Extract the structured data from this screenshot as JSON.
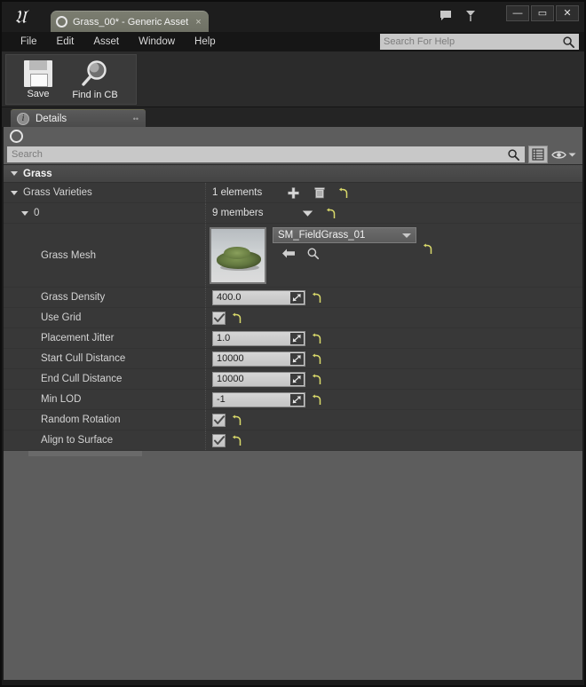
{
  "window": {
    "logo": "ue-logo",
    "asset_tab": {
      "title": "Grass_00* - Generic Asset",
      "close": "×"
    },
    "controls": {
      "minimize": "—",
      "maximize": "▭",
      "close": "✕"
    },
    "title_icons": [
      "feedback-icon",
      "bookmark-icon"
    ]
  },
  "menubar": {
    "items": [
      "File",
      "Edit",
      "Asset",
      "Window",
      "Help"
    ],
    "help_search_placeholder": "Search For Help"
  },
  "toolbar": {
    "buttons": [
      {
        "label": "Save",
        "icon": "save-icon"
      },
      {
        "label": "Find in CB",
        "icon": "magnifier-icon"
      }
    ]
  },
  "details_panel": {
    "tab_label": "Details",
    "tab_icon": "info-icon",
    "search_placeholder": "Search",
    "view_buttons": [
      "grid-view-icon",
      "eye-icon",
      "chevron-down-icon"
    ]
  },
  "properties": {
    "category": "Grass",
    "array": {
      "name": "Grass Varieties",
      "value": "1 elements",
      "actions": [
        "add-element-icon",
        "delete-all-icon",
        "reset-icon"
      ]
    },
    "element": {
      "name": "0",
      "value": "9 members",
      "actions": [
        "dropdown-arrow-icon",
        "reset-icon"
      ]
    },
    "mesh": {
      "name": "Grass Mesh",
      "asset": "SM_FieldGrass_01",
      "thumbnail": "grass-mesh-thumbnail",
      "actions": [
        "use-selected-icon",
        "browse-icon",
        "reset-icon"
      ]
    },
    "rows": [
      {
        "name": "Grass Density",
        "type": "number",
        "value": "400.0"
      },
      {
        "name": "Use Grid",
        "type": "checkbox",
        "value": "✓"
      },
      {
        "name": "Placement Jitter",
        "type": "number",
        "value": "1.0"
      },
      {
        "name": "Start Cull Distance",
        "type": "number",
        "value": "10000"
      },
      {
        "name": "End Cull Distance",
        "type": "number",
        "value": "10000"
      },
      {
        "name": "Min LOD",
        "type": "number",
        "value": "-1"
      },
      {
        "name": "Random Rotation",
        "type": "checkbox",
        "value": "✓"
      },
      {
        "name": "Align to Surface",
        "type": "checkbox",
        "value": "✓"
      }
    ]
  },
  "colors": {
    "window_bg": "#262626",
    "panel_bg": "#5d5d5d",
    "proplist_bg": "#383838",
    "category_bg": "#4a4a4a",
    "field_bg": "#c8c8c8",
    "reset_yellow": "#d8d86a",
    "tab_green": "#7b7d70"
  }
}
